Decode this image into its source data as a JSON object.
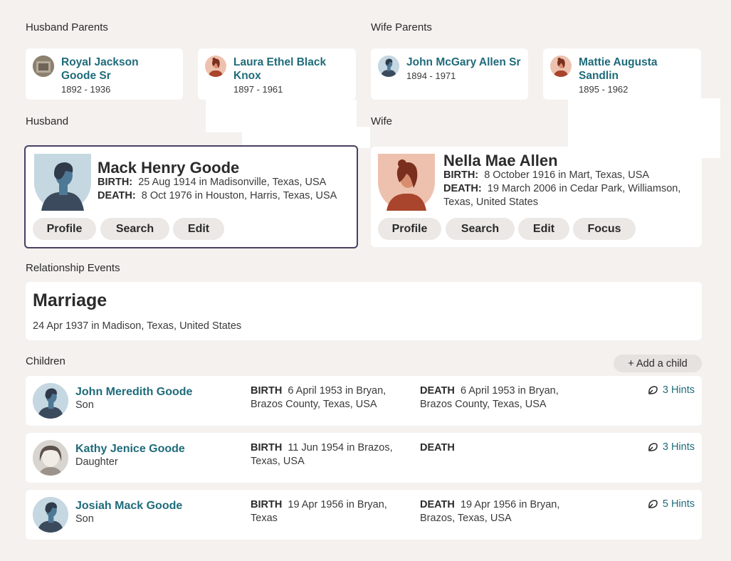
{
  "labels": {
    "husband_parents": "Husband Parents",
    "wife_parents": "Wife Parents",
    "husband": "Husband",
    "wife": "Wife",
    "relationship_events": "Relationship Events",
    "children": "Children"
  },
  "husband_parents": [
    {
      "name": "Royal Jackson Goode Sr",
      "dates": "1892 - 1936",
      "avatar": "photo"
    },
    {
      "name": "Laura Ethel Black Knox",
      "dates": "1897 - 1961",
      "avatar": "female-icon"
    }
  ],
  "wife_parents": [
    {
      "name": "John McGary Allen Sr",
      "dates": "1894 - 1971",
      "avatar": "male-icon"
    },
    {
      "name": "Mattie Augusta Sandlin",
      "dates": "1895 - 1962",
      "avatar": "female-icon"
    }
  ],
  "husband": {
    "name": "Mack Henry Goode",
    "birth_label": "BIRTH:",
    "birth": "25 Aug 1914 in Madisonville, Texas, USA",
    "death_label": "DEATH:",
    "death": "8 Oct 1976 in Houston, Harris, Texas, USA",
    "buttons": [
      "Profile",
      "Search",
      "Edit"
    ]
  },
  "wife": {
    "name": "Nella Mae Allen",
    "birth_label": "BIRTH:",
    "birth": "8 October 1916 in Mart, Texas, USA",
    "death_label": "DEATH:",
    "death_line1": "19 March 2006 in Cedar Park, Williamson,",
    "death_line2": "Texas, United States",
    "buttons": [
      "Profile",
      "Search",
      "Edit",
      "Focus"
    ]
  },
  "marriage": {
    "title": "Marriage",
    "details": "24 Apr 1937 in Madison, Texas, United States"
  },
  "add_child": "+ Add a child",
  "children": [
    {
      "name": "John Meredith Goode",
      "relation": "Son",
      "birth_label": "BIRTH",
      "birth_line1": "6 April 1953  in Bryan,",
      "birth_line2": "Brazos County, Texas, USA",
      "death_label": "DEATH",
      "death_line1": "6 April 1953  in Bryan,",
      "death_line2": "Brazos County, Texas, USA",
      "hints": "3 Hints"
    },
    {
      "name": "Kathy Jenice Goode",
      "relation": "Daughter",
      "birth_label": "BIRTH",
      "birth_line1": "11 Jun 1954  in Brazos,",
      "birth_line2": "Texas, USA",
      "death_label": "DEATH",
      "death_line1": "",
      "death_line2": "",
      "hints": "3 Hints"
    },
    {
      "name": "Josiah Mack Goode",
      "relation": "Son",
      "birth_label": "BIRTH",
      "birth_line1": "19 Apr 1956  in Bryan,",
      "birth_line2": "Texas",
      "death_label": "DEATH",
      "death_line1": "19 Apr 1956  in Bryan,",
      "death_line2": "Brazos, Texas, USA",
      "hints": "5 Hints"
    }
  ],
  "colors": {
    "link": "#1f6b7a",
    "male_bg": "#c5d8e2",
    "male_fg": "#3b4a5c",
    "female_bg": "#eec1ae",
    "female_fg": "#a8452c",
    "selected_border": "#4a3f63"
  }
}
